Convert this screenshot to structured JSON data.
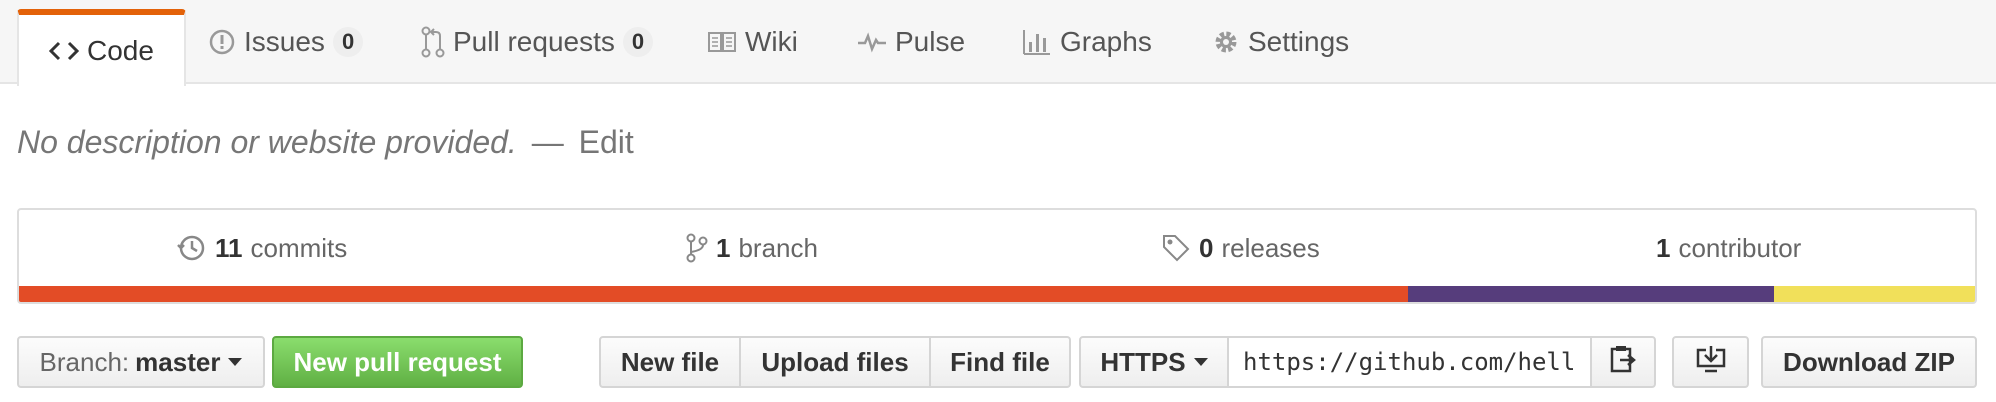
{
  "tabs": [
    {
      "id": "code",
      "label": "Code",
      "icon": "code-icon",
      "selected": true
    },
    {
      "id": "issues",
      "label": "Issues",
      "icon": "issue-opened-icon",
      "count": "0"
    },
    {
      "id": "pull-requests",
      "label": "Pull requests",
      "icon": "git-pull-request-icon",
      "count": "0"
    },
    {
      "id": "wiki",
      "label": "Wiki",
      "icon": "book-icon"
    },
    {
      "id": "pulse",
      "label": "Pulse",
      "icon": "pulse-icon"
    },
    {
      "id": "graphs",
      "label": "Graphs",
      "icon": "graph-icon"
    },
    {
      "id": "settings",
      "label": "Settings",
      "icon": "gear-icon"
    }
  ],
  "description": {
    "text": "No description or website provided.",
    "separator": "—",
    "edit_label": "Edit"
  },
  "summary": {
    "commits": {
      "num": "11",
      "label": "commits",
      "icon": "history-icon"
    },
    "branches": {
      "num": "1",
      "label": "branch",
      "icon": "git-branch-icon"
    },
    "releases": {
      "num": "0",
      "label": "releases",
      "icon": "tag-icon"
    },
    "contributors": {
      "num": "1",
      "label": "contributor"
    }
  },
  "languages": [
    {
      "color": "#e34c26",
      "percent": 71
    },
    {
      "color": "#563d7c",
      "percent": 18.7
    },
    {
      "color": "#f1e05a",
      "percent": 10.3
    }
  ],
  "toolbar": {
    "branch_prefix": "Branch:",
    "branch_name": "master",
    "new_pull_request": "New pull request",
    "new_file": "New file",
    "upload_files": "Upload files",
    "find_file": "Find file",
    "protocol": "HTTPS",
    "clone_url": "https://github.com/hell",
    "copy_icon": "clippy-icon",
    "desktop_icon": "desktop-download-icon",
    "download_zip": "Download ZIP"
  }
}
